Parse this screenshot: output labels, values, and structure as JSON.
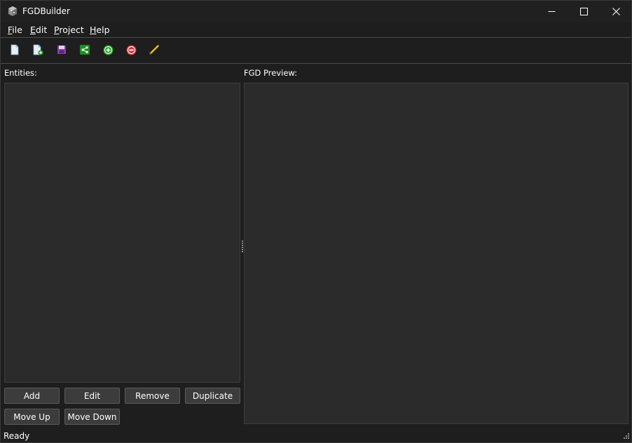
{
  "window": {
    "title": "FGDBuilder"
  },
  "menu": {
    "items": [
      {
        "accel": "F",
        "rest": "ile"
      },
      {
        "accel": "E",
        "rest": "dit"
      },
      {
        "accel": "P",
        "rest": "roject"
      },
      {
        "accel": "H",
        "rest": "elp"
      }
    ]
  },
  "toolbar": {
    "icons": [
      "new-file-icon",
      "new-from-template-icon",
      "save-icon",
      "export-icon",
      "add-icon",
      "remove-icon",
      "edit-pencil-icon"
    ]
  },
  "entities": {
    "label": "Entities:",
    "buttons": {
      "add": "Add",
      "edit": "Edit",
      "remove": "Remove",
      "duplicate": "Duplicate",
      "move_up": "Move Up",
      "move_down": "Move Down"
    }
  },
  "preview": {
    "label": "FGD Preview:"
  },
  "status": {
    "text": "Ready"
  },
  "colors": {
    "background": "#1e1e1e",
    "pane": "#2b2b2b",
    "button": "#3c3c3c",
    "green_accent": "#1ea31e",
    "red_accent": "#d0343a",
    "pencil": "#e8c21c"
  }
}
